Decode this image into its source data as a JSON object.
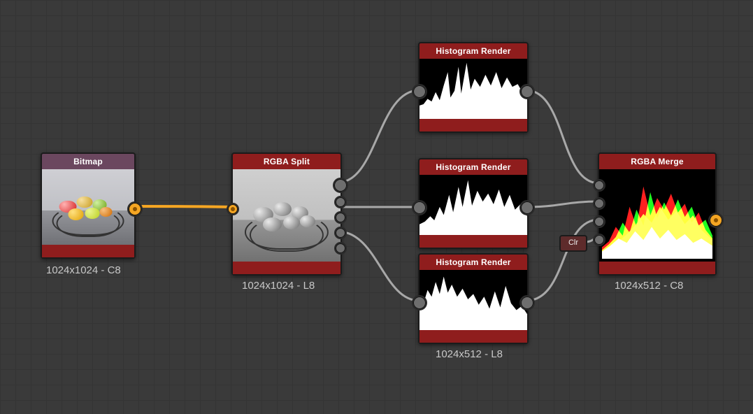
{
  "nodes": {
    "bitmap": {
      "title": "Bitmap",
      "caption": "1024x1024 - C8"
    },
    "rgba_split": {
      "title": "RGBA Split",
      "caption": "1024x1024 - L8"
    },
    "hist1": {
      "title": "Histogram Render"
    },
    "hist2": {
      "title": "Histogram Render"
    },
    "hist3": {
      "title": "Histogram Render",
      "caption": "1024x512 - L8"
    },
    "rgba_merge": {
      "title": "RGBA Merge",
      "caption": "1024x512 - C8"
    }
  },
  "chips": {
    "clr": "Clr"
  }
}
